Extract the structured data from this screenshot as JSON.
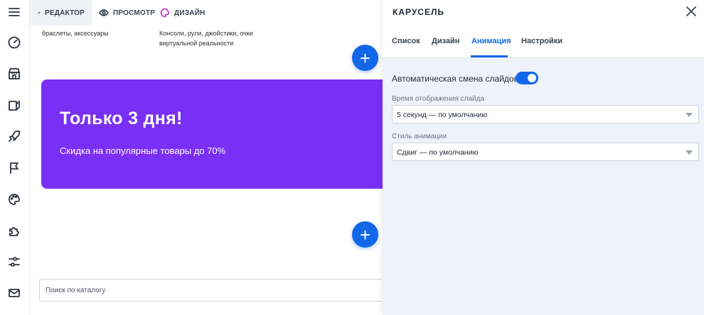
{
  "rail": {
    "icons": [
      "menu-icon",
      "dashboard-icon",
      "store-icon",
      "catalog-icon",
      "rocket-icon",
      "flag-icon",
      "palette-icon",
      "puzzle-icon",
      "sliders-icon",
      "mail-icon"
    ]
  },
  "modebar": {
    "editor_label": "РЕДАКТОР",
    "preview_label": "ПРОСМОТР",
    "design_label": "ДИЗАЙН"
  },
  "canvas": {
    "category_left": "браслеты, аксессуары",
    "category_right_line1": "Консоли, рули, джойстики, очки",
    "category_right_line2": "виртуальной реальности",
    "add_symbol": "+",
    "banner": {
      "title": "Только 3 дня!",
      "subtitle": "Скидка на популярные товары до 70%",
      "color": "#7a2ff5"
    },
    "search_placeholder": "Поиск по каталогу"
  },
  "panel": {
    "title": "КАРУСЕЛЬ",
    "tabs": [
      {
        "label": "Список"
      },
      {
        "label": "Дизайн"
      },
      {
        "label": "Анимация",
        "active": true
      },
      {
        "label": "Настройки"
      }
    ],
    "autoplay_label": "Автоматическая смена слайдов",
    "autoplay_on": true,
    "slide_time_label": "Время отображения слайда",
    "slide_time_value": "5 секунд — по умолчанию",
    "animation_style_label": "Стиль анимации",
    "animation_style_value": "Сдвиг — по умолчанию"
  },
  "colors": {
    "accent": "#1267e8",
    "panel_bg": "#eef3fb"
  }
}
